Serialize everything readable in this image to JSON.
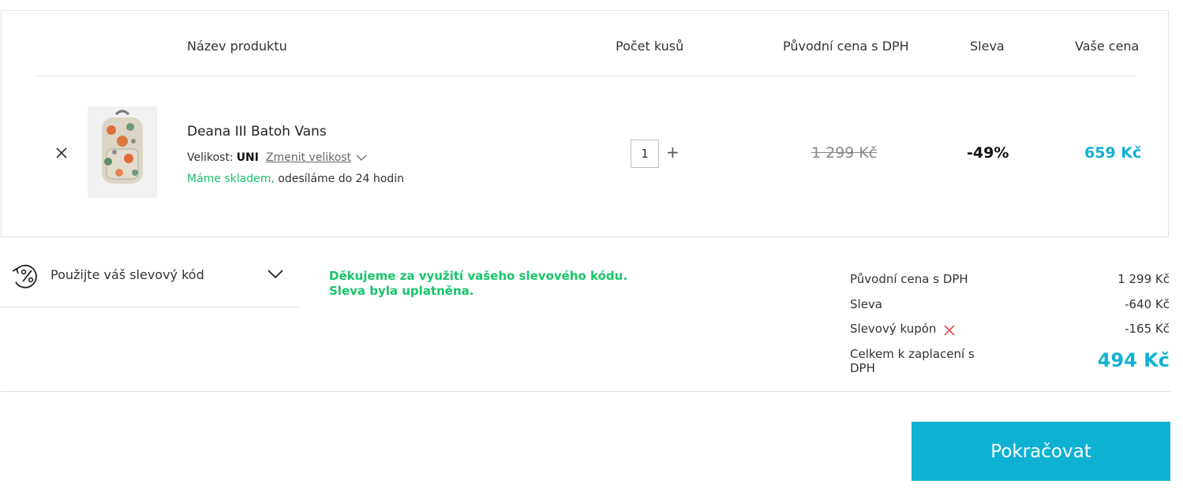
{
  "table_header": {
    "product_name": "Název produktu",
    "quantity": "Počet kusů",
    "original_price": "Původní cena s DPH",
    "discount": "Sleva",
    "your_price": "Vaše cena"
  },
  "cart_item": {
    "name": "Deana III Batoh Vans",
    "size_label": "Velikost:",
    "size_value": "UNI",
    "change_size": "Zmenit velikost",
    "stock_status": "Máme skladem,",
    "shipping_note": " odesíláme do 24 hodin",
    "quantity": "1",
    "plus": "+",
    "original_price": "1 299 Kč",
    "discount": "-49%",
    "your_price": "659 Kč"
  },
  "coupon": {
    "toggle_label": "Použijte váš slevový kód",
    "thanks_line1": "Děkujeme za využití vašeho slevového kódu.",
    "thanks_line2": "Sleva byla uplatněna."
  },
  "summary": {
    "original_label": "Původní cena s DPH",
    "original_value": "1 299 Kč",
    "discount_label": "Sleva",
    "discount_value": "-640 Kč",
    "coupon_label": "Slevový kupón",
    "coupon_value": "-165 Kč",
    "total_label": "Celkem k zaplacení s DPH",
    "total_value": "494 Kč"
  },
  "actions": {
    "continue_label": "Pokračovat"
  },
  "icons": {
    "remove": "close-icon",
    "size_dropdown": "chevron-down-icon",
    "coupon": "percent-refresh-icon",
    "coupon_toggle": "chevron-down-icon",
    "coupon_remove": "close-icon"
  },
  "colors": {
    "accent": "#0fb1d3",
    "success": "#17c56a",
    "danger": "#e5333a"
  }
}
